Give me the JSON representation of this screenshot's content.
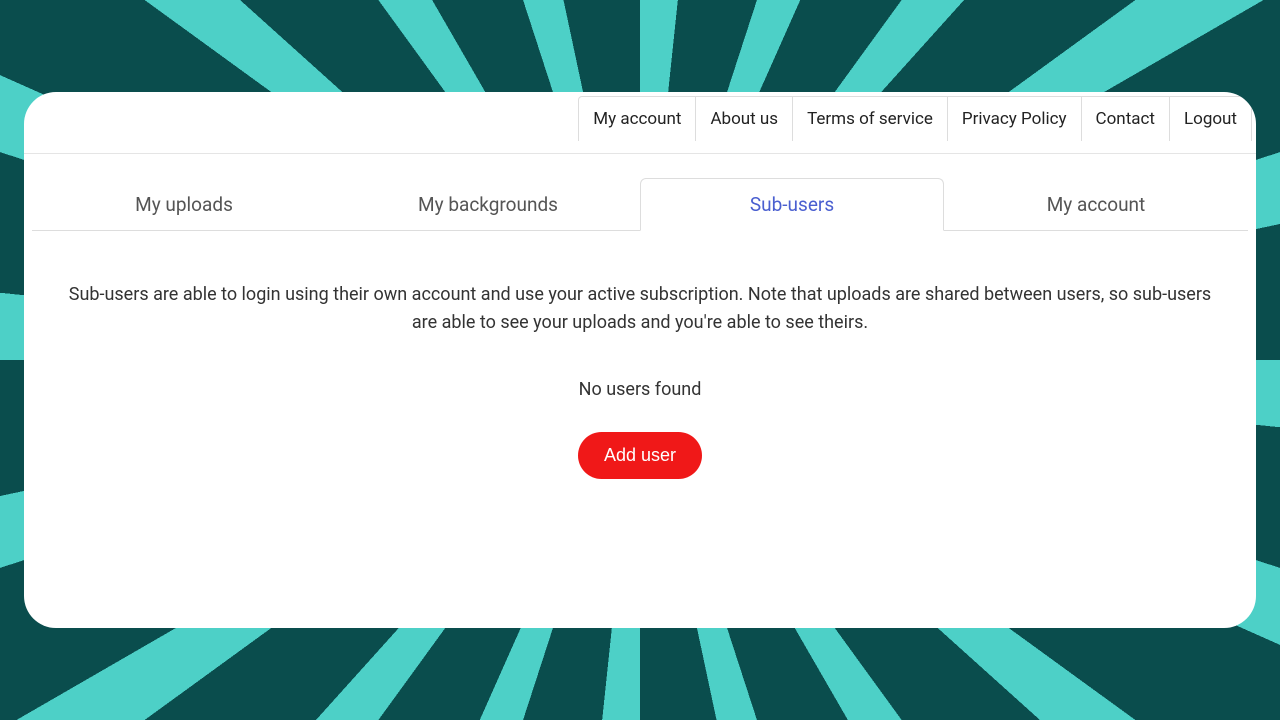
{
  "topNav": {
    "items": [
      {
        "label": "My account"
      },
      {
        "label": "About us"
      },
      {
        "label": "Terms of service"
      },
      {
        "label": "Privacy Policy"
      },
      {
        "label": "Contact"
      },
      {
        "label": "Logout"
      }
    ]
  },
  "tabs": {
    "items": [
      {
        "label": "My uploads",
        "active": false
      },
      {
        "label": "My backgrounds",
        "active": false
      },
      {
        "label": "Sub-users",
        "active": true
      },
      {
        "label": "My account",
        "active": false
      }
    ]
  },
  "content": {
    "description": "Sub-users are able to login using their own account and use your active subscription. Note that uploads are shared between users, so sub-users are able to see your uploads and you're able to see theirs.",
    "emptyMessage": "No users found",
    "addButton": "Add user"
  }
}
